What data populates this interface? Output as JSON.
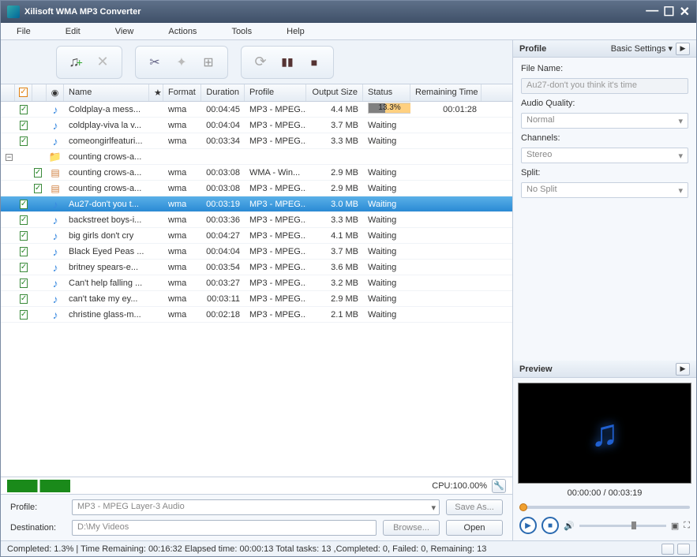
{
  "window": {
    "title": "Xilisoft WMA MP3 Converter"
  },
  "menu": [
    "File",
    "Edit",
    "View",
    "Actions",
    "Tools",
    "Help"
  ],
  "columns": [
    "",
    "",
    "Name",
    "",
    "Format",
    "Duration",
    "Profile",
    "Output Size",
    "Status",
    "Remaining Time"
  ],
  "files": [
    {
      "chk": true,
      "ico": "note",
      "name": "Coldplay-a mess...",
      "fmt": "wma",
      "dur": "00:04:45",
      "prof": "MP3 - MPEG...",
      "size": "4.4 MB",
      "stat": "13.3%",
      "rem": "00:01:28",
      "progress": true
    },
    {
      "chk": true,
      "ico": "note",
      "name": "coldplay-viva la v...",
      "fmt": "wma",
      "dur": "00:04:04",
      "prof": "MP3 - MPEG...",
      "size": "3.7 MB",
      "stat": "Waiting",
      "rem": ""
    },
    {
      "chk": true,
      "ico": "note",
      "name": "comeongirlfeaturi...",
      "fmt": "wma",
      "dur": "00:03:34",
      "prof": "MP3 - MPEG...",
      "size": "3.3 MB",
      "stat": "Waiting",
      "rem": ""
    },
    {
      "chk": false,
      "ico": "folder",
      "name": "counting crows-a...",
      "fmt": "",
      "dur": "",
      "prof": "",
      "size": "",
      "stat": "",
      "rem": "",
      "folder": true
    },
    {
      "chk": true,
      "ico": "doc",
      "name": "counting crows-a...",
      "fmt": "wma",
      "dur": "00:03:08",
      "prof": "WMA - Win...",
      "size": "2.9 MB",
      "stat": "Waiting",
      "rem": "",
      "indent": true
    },
    {
      "chk": true,
      "ico": "doc",
      "name": "counting crows-a...",
      "fmt": "wma",
      "dur": "00:03:08",
      "prof": "MP3 - MPEG...",
      "size": "2.9 MB",
      "stat": "Waiting",
      "rem": "",
      "indent": true
    },
    {
      "chk": true,
      "ico": "note",
      "name": "Au27-don't you t...",
      "fmt": "wma",
      "dur": "00:03:19",
      "prof": "MP3 - MPEG...",
      "size": "3.0 MB",
      "stat": "Waiting",
      "rem": "",
      "selected": true
    },
    {
      "chk": true,
      "ico": "note",
      "name": "backstreet boys-i...",
      "fmt": "wma",
      "dur": "00:03:36",
      "prof": "MP3 - MPEG...",
      "size": "3.3 MB",
      "stat": "Waiting",
      "rem": ""
    },
    {
      "chk": true,
      "ico": "note",
      "name": "big girls don't cry",
      "fmt": "wma",
      "dur": "00:04:27",
      "prof": "MP3 - MPEG...",
      "size": "4.1 MB",
      "stat": "Waiting",
      "rem": ""
    },
    {
      "chk": true,
      "ico": "note",
      "name": "Black Eyed Peas ...",
      "fmt": "wma",
      "dur": "00:04:04",
      "prof": "MP3 - MPEG...",
      "size": "3.7 MB",
      "stat": "Waiting",
      "rem": ""
    },
    {
      "chk": true,
      "ico": "note",
      "name": "britney spears-e...",
      "fmt": "wma",
      "dur": "00:03:54",
      "prof": "MP3 - MPEG...",
      "size": "3.6 MB",
      "stat": "Waiting",
      "rem": ""
    },
    {
      "chk": true,
      "ico": "note",
      "name": "Can't help falling ...",
      "fmt": "wma",
      "dur": "00:03:27",
      "prof": "MP3 - MPEG...",
      "size": "3.2 MB",
      "stat": "Waiting",
      "rem": ""
    },
    {
      "chk": true,
      "ico": "note",
      "name": "can't take my ey...",
      "fmt": "wma",
      "dur": "00:03:11",
      "prof": "MP3 - MPEG...",
      "size": "2.9 MB",
      "stat": "Waiting",
      "rem": ""
    },
    {
      "chk": true,
      "ico": "note",
      "name": "christine glass-m...",
      "fmt": "wma",
      "dur": "00:02:18",
      "prof": "MP3 - MPEG...",
      "size": "2.1 MB",
      "stat": "Waiting",
      "rem": ""
    }
  ],
  "cpu": "CPU:100.00%",
  "bottom": {
    "profile_label": "Profile:",
    "profile_value": "MP3 - MPEG Layer-3 Audio",
    "save_as": "Save As...",
    "dest_label": "Destination:",
    "dest_value": "D:\\My Videos",
    "browse": "Browse...",
    "open": "Open"
  },
  "profile_panel": {
    "title": "Profile",
    "basic": "Basic Settings",
    "filename_lbl": "File Name:",
    "filename": "Au27-don't you think it's time",
    "quality_lbl": "Audio Quality:",
    "quality": "Normal",
    "channels_lbl": "Channels:",
    "channels": "Stereo",
    "split_lbl": "Split:",
    "split": "No Split"
  },
  "preview": {
    "title": "Preview",
    "time": "00:00:00 / 00:03:19"
  },
  "status": "Completed: 1.3% | Time Remaining: 00:16:32 Elapsed time: 00:00:13 Total tasks: 13 ,Completed: 0, Failed: 0, Remaining: 13"
}
